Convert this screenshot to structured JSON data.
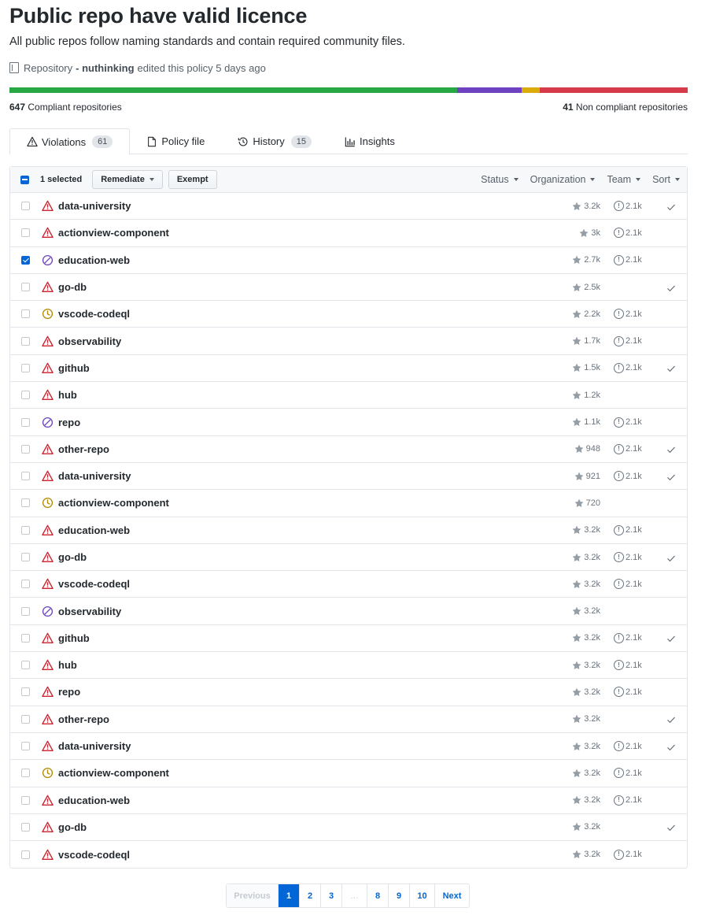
{
  "header": {
    "title": "Public repo have valid licence",
    "subtitle": "All public repos follow naming standards and contain required community files.",
    "meta_prefix": "Repository",
    "meta_user": "- nuthinking",
    "meta_suffix": "edited this policy 5 days ago"
  },
  "progress": {
    "segments": [
      {
        "status": "compliant",
        "fraction": 0.66,
        "color": "#28a745"
      },
      {
        "status": "exempt",
        "fraction": 0.095,
        "color": "#6f42c1"
      },
      {
        "status": "pending",
        "fraction": 0.027,
        "color": "#dbab09"
      },
      {
        "status": "violation",
        "fraction": 0.218,
        "color": "#d73a49"
      }
    ],
    "compliant_count": "647",
    "compliant_label": "Compliant repositories",
    "noncompliant_count": "41",
    "noncompliant_label": "Non compliant repositories"
  },
  "tabs": [
    {
      "label": "Violations",
      "counter": "61",
      "icon": "alert-icon",
      "active": true
    },
    {
      "label": "Policy file",
      "counter": "",
      "icon": "file-icon",
      "active": false
    },
    {
      "label": "History",
      "counter": "15",
      "icon": "history-icon",
      "active": false
    },
    {
      "label": "Insights",
      "counter": "",
      "icon": "graph-icon",
      "active": false
    }
  ],
  "toolbar": {
    "selected_label": "1 selected",
    "remediate_label": "Remediate",
    "exempt_label": "Exempt",
    "filters": [
      "Status",
      "Organization",
      "Team",
      "Sort"
    ]
  },
  "status_colors": {
    "violation": "#cb2431",
    "exempt": "#6f42c1",
    "pending": "#b08800"
  },
  "rows": [
    {
      "name": "data-university",
      "status": "violation",
      "stars": "3.2k",
      "issues": "2.1k",
      "checked": false,
      "compliant": true
    },
    {
      "name": "actionview-component",
      "status": "violation",
      "stars": "3k",
      "issues": "2.1k",
      "checked": false,
      "compliant": false
    },
    {
      "name": "education-web",
      "status": "exempt",
      "stars": "2.7k",
      "issues": "2.1k",
      "checked": true,
      "compliant": false
    },
    {
      "name": "go-db",
      "status": "violation",
      "stars": "2.5k",
      "issues": "",
      "checked": false,
      "compliant": true
    },
    {
      "name": "vscode-codeql",
      "status": "pending",
      "stars": "2.2k",
      "issues": "2.1k",
      "checked": false,
      "compliant": false
    },
    {
      "name": "observability",
      "status": "violation",
      "stars": "1.7k",
      "issues": "2.1k",
      "checked": false,
      "compliant": false
    },
    {
      "name": "github",
      "status": "violation",
      "stars": "1.5k",
      "issues": "2.1k",
      "checked": false,
      "compliant": true
    },
    {
      "name": "hub",
      "status": "violation",
      "stars": "1.2k",
      "issues": "",
      "checked": false,
      "compliant": false
    },
    {
      "name": "repo",
      "status": "exempt",
      "stars": "1.1k",
      "issues": "2.1k",
      "checked": false,
      "compliant": false
    },
    {
      "name": "other-repo",
      "status": "violation",
      "stars": "948",
      "issues": "2.1k",
      "checked": false,
      "compliant": true
    },
    {
      "name": "data-university",
      "status": "violation",
      "stars": "921",
      "issues": "2.1k",
      "checked": false,
      "compliant": true
    },
    {
      "name": "actionview-component",
      "status": "pending",
      "stars": "720",
      "issues": "",
      "checked": false,
      "compliant": false
    },
    {
      "name": "education-web",
      "status": "violation",
      "stars": "3.2k",
      "issues": "2.1k",
      "checked": false,
      "compliant": false
    },
    {
      "name": "go-db",
      "status": "violation",
      "stars": "3.2k",
      "issues": "2.1k",
      "checked": false,
      "compliant": true
    },
    {
      "name": "vscode-codeql",
      "status": "violation",
      "stars": "3.2k",
      "issues": "2.1k",
      "checked": false,
      "compliant": false
    },
    {
      "name": "observability",
      "status": "exempt",
      "stars": "3.2k",
      "issues": "",
      "checked": false,
      "compliant": false
    },
    {
      "name": "github",
      "status": "violation",
      "stars": "3.2k",
      "issues": "2.1k",
      "checked": false,
      "compliant": true
    },
    {
      "name": "hub",
      "status": "violation",
      "stars": "3.2k",
      "issues": "2.1k",
      "checked": false,
      "compliant": false
    },
    {
      "name": "repo",
      "status": "violation",
      "stars": "3.2k",
      "issues": "2.1k",
      "checked": false,
      "compliant": false
    },
    {
      "name": "other-repo",
      "status": "violation",
      "stars": "3.2k",
      "issues": "",
      "checked": false,
      "compliant": true
    },
    {
      "name": "data-university",
      "status": "violation",
      "stars": "3.2k",
      "issues": "2.1k",
      "checked": false,
      "compliant": true
    },
    {
      "name": "actionview-component",
      "status": "pending",
      "stars": "3.2k",
      "issues": "2.1k",
      "checked": false,
      "compliant": false
    },
    {
      "name": "education-web",
      "status": "violation",
      "stars": "3.2k",
      "issues": "2.1k",
      "checked": false,
      "compliant": false
    },
    {
      "name": "go-db",
      "status": "violation",
      "stars": "3.2k",
      "issues": "",
      "checked": false,
      "compliant": true
    },
    {
      "name": "vscode-codeql",
      "status": "violation",
      "stars": "3.2k",
      "issues": "2.1k",
      "checked": false,
      "compliant": false
    }
  ],
  "pagination": {
    "previous_label": "Previous",
    "next_label": "Next",
    "pages": [
      "1",
      "2",
      "3",
      "…",
      "8",
      "9",
      "10"
    ],
    "current": "1"
  }
}
